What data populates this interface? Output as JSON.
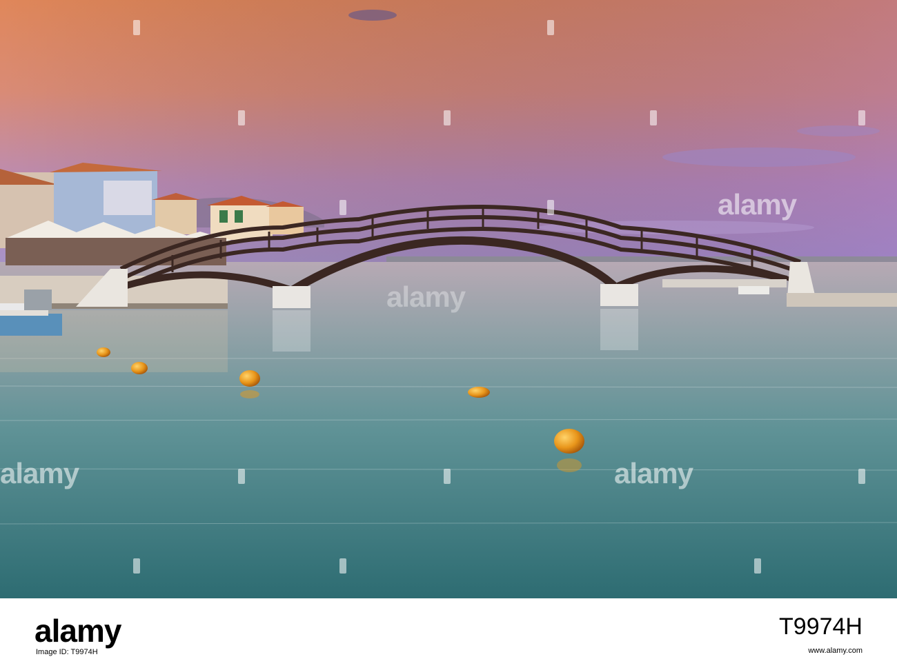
{
  "photo": {
    "sky_colors": [
      "#e58a52",
      "#d98a78",
      "#b98ab5",
      "#a892c9"
    ],
    "water_colors": [
      "#a8a6b4",
      "#6e9aa0",
      "#3f7d82",
      "#2f6f74"
    ],
    "bridge_color": "#3b2722",
    "buoy_color": "#e59a1c",
    "watermark_text": "alamy"
  },
  "footer": {
    "logo": "alamy",
    "image_id": "T9974H",
    "subtitle": "Image ID: T9974H",
    "url": "www.alamy.com"
  }
}
